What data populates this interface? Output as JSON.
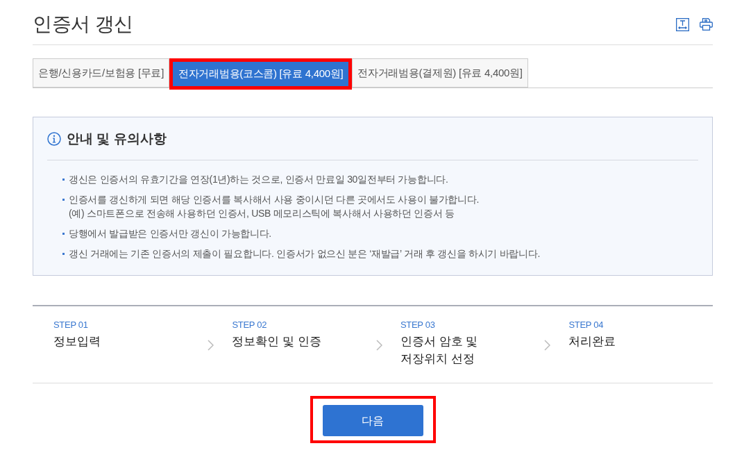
{
  "page": {
    "title": "인증서 갱신"
  },
  "tabs": [
    {
      "label": "은행/신용카드/보험용 [무료]",
      "selected": false,
      "highlighted": false
    },
    {
      "label": "전자거래범용(코스콤) [유료 4,400원]",
      "selected": true,
      "highlighted": true
    },
    {
      "label": "전자거래범용(결제원) [유료 4,400원]",
      "selected": false,
      "highlighted": false
    }
  ],
  "notice": {
    "title": "안내 및 유의사항",
    "items": [
      {
        "lines": [
          "갱신은 인증서의 유효기간을 연장(1년)하는 것으로, 인증서 만료일 30일전부터 가능합니다."
        ]
      },
      {
        "lines": [
          "인증서를 갱신하게 되면 해당 인증서를 복사해서 사용 중이시던 다른 곳에서도 사용이 불가합니다.",
          "(예) 스마트폰으로 전송해 사용하던 인증서, USB 메모리스틱에 복사해서 사용하던 인증서 등"
        ]
      },
      {
        "lines": [
          "당행에서 발급받은 인증서만 갱신이 가능합니다."
        ]
      },
      {
        "lines": [
          "갱신 거래에는 기존 인증서의 제출이 필요합니다. 인증서가 없으신 분은 ‘재발급’ 거래 후 갱신을 하시기 바랍니다."
        ]
      }
    ]
  },
  "steps": [
    {
      "number": "STEP 01",
      "title_lines": [
        "정보입력"
      ]
    },
    {
      "number": "STEP 02",
      "title_lines": [
        "정보확인 및 인증"
      ]
    },
    {
      "number": "STEP 03",
      "title_lines": [
        "인증서 암호 및",
        "저장위치 선정"
      ]
    },
    {
      "number": "STEP 04",
      "title_lines": [
        "처리완료"
      ]
    }
  ],
  "next_button": {
    "label": "다음",
    "highlighted": true
  }
}
